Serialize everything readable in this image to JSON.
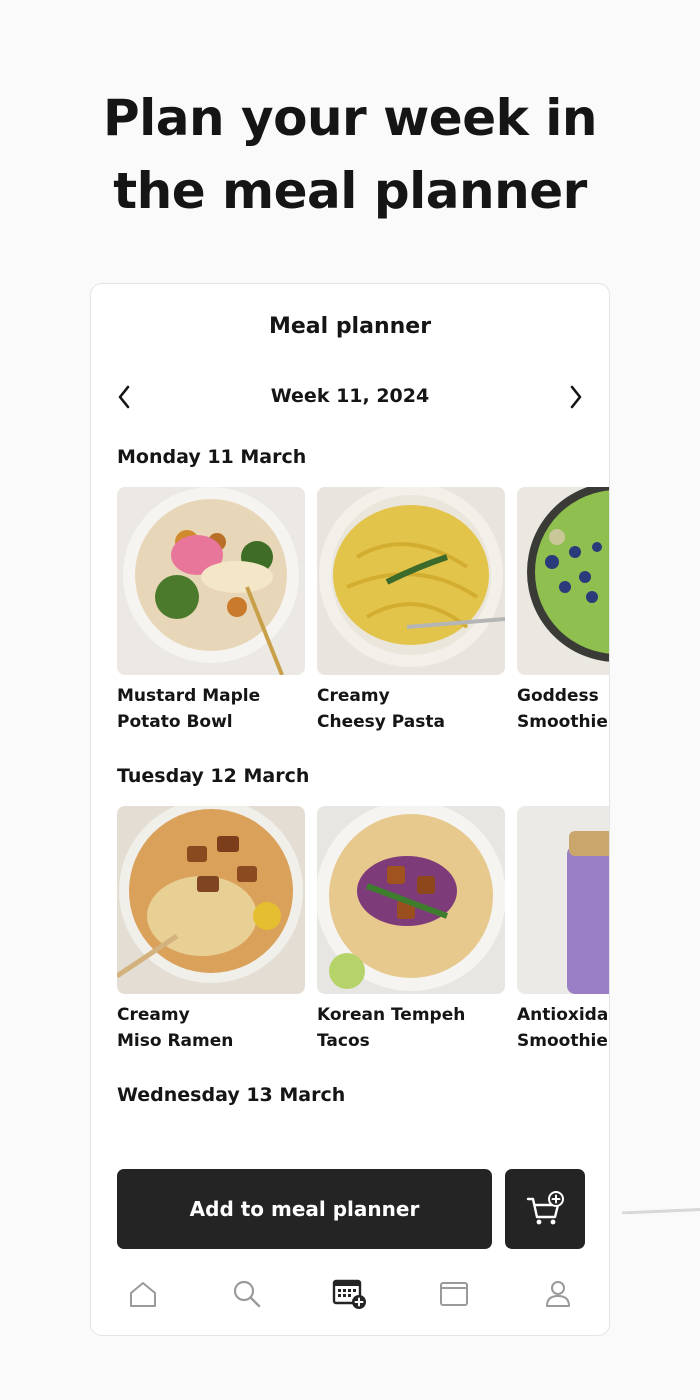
{
  "headline": {
    "line1": "Plan your week in",
    "line2": "the meal planner"
  },
  "planner": {
    "title": "Meal planner",
    "week_label": "Week 11, 2024",
    "days": [
      {
        "label": "Monday 11 March",
        "meals": [
          {
            "line1": "Mustard Maple",
            "line2": "Potato Bowl"
          },
          {
            "line1": "Creamy",
            "line2": "Cheesy Pasta"
          },
          {
            "line1": "Goddess",
            "line2": "Smoothie"
          }
        ]
      },
      {
        "label": "Tuesday 12 March",
        "meals": [
          {
            "line1": "Creamy",
            "line2": "Miso Ramen"
          },
          {
            "line1": "Korean Tempeh",
            "line2": "Tacos"
          },
          {
            "line1": "Antioxidant",
            "line2": "Smoothie"
          }
        ]
      },
      {
        "label": "Wednesday 13 March",
        "meals": []
      }
    ],
    "add_button_label": "Add to meal planner"
  },
  "tabs": [
    {
      "icon": "home-icon"
    },
    {
      "icon": "search-icon"
    },
    {
      "icon": "meal-planner-icon"
    },
    {
      "icon": "browser-icon"
    },
    {
      "icon": "profile-icon"
    }
  ],
  "colors": {
    "background": "#fafafa",
    "card": "#ffffff",
    "button": "#242424",
    "text": "#151515"
  }
}
